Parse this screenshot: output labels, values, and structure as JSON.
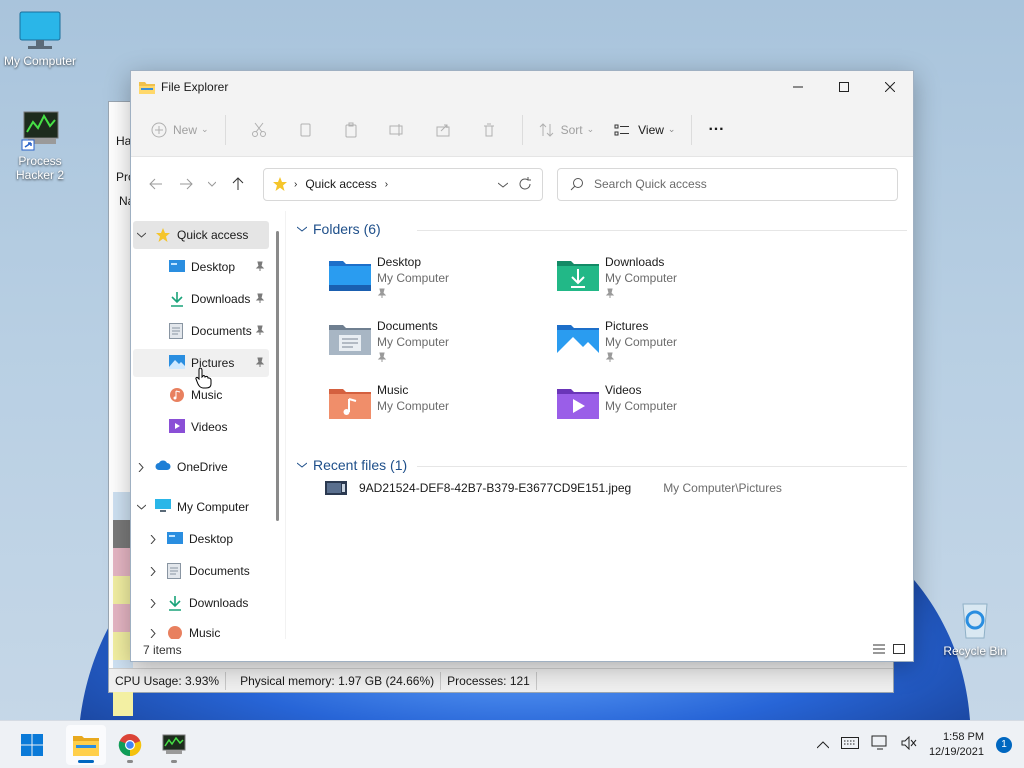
{
  "desktop": {
    "icons": [
      {
        "label": "My Computer"
      },
      {
        "label": "Process Hacker 2"
      },
      {
        "label": "Recycle Bin"
      }
    ]
  },
  "process_hacker": {
    "status_cpu": "CPU Usage: 3.93%",
    "status_memory": "Physical memory: 1.97 GB (24.66%)",
    "status_processes": "Processes: 121",
    "partial_labels": [
      "Ha",
      "Pro",
      "Na"
    ]
  },
  "explorer": {
    "window_title": "File Explorer",
    "toolbar": {
      "new_label": "New",
      "sort_label": "Sort",
      "view_label": "View",
      "more_label": "···"
    },
    "address": {
      "location": "Quick access"
    },
    "search": {
      "placeholder": "Search Quick access"
    },
    "nav": {
      "quick_access": "Quick access",
      "quick_items": [
        "Desktop",
        "Downloads",
        "Documents",
        "Pictures",
        "Music",
        "Videos"
      ],
      "onedrive": "OneDrive",
      "my_computer": "My Computer",
      "computer_items": [
        "Desktop",
        "Documents",
        "Downloads",
        "Music"
      ]
    },
    "folders_header": "Folders (6)",
    "folders": [
      {
        "name": "Desktop",
        "location": "My Computer"
      },
      {
        "name": "Downloads",
        "location": "My Computer"
      },
      {
        "name": "Documents",
        "location": "My Computer"
      },
      {
        "name": "Pictures",
        "location": "My Computer"
      },
      {
        "name": "Music",
        "location": "My Computer"
      },
      {
        "name": "Videos",
        "location": "My Computer"
      }
    ],
    "recent_header": "Recent files (1)",
    "recent_files": [
      {
        "name": "9AD21524-DEF8-42B7-B379-E3677CD9E151.jpeg",
        "path": "My Computer\\Pictures"
      }
    ],
    "status_items": "7 items"
  },
  "taskbar": {
    "time": "1:58 PM",
    "date": "12/19/2021",
    "notification_count": "1"
  },
  "colors": {
    "accent": "#0067c0",
    "folder_yellow": "#f0c14b",
    "wallpaper_blue": "#1f5fd6"
  }
}
